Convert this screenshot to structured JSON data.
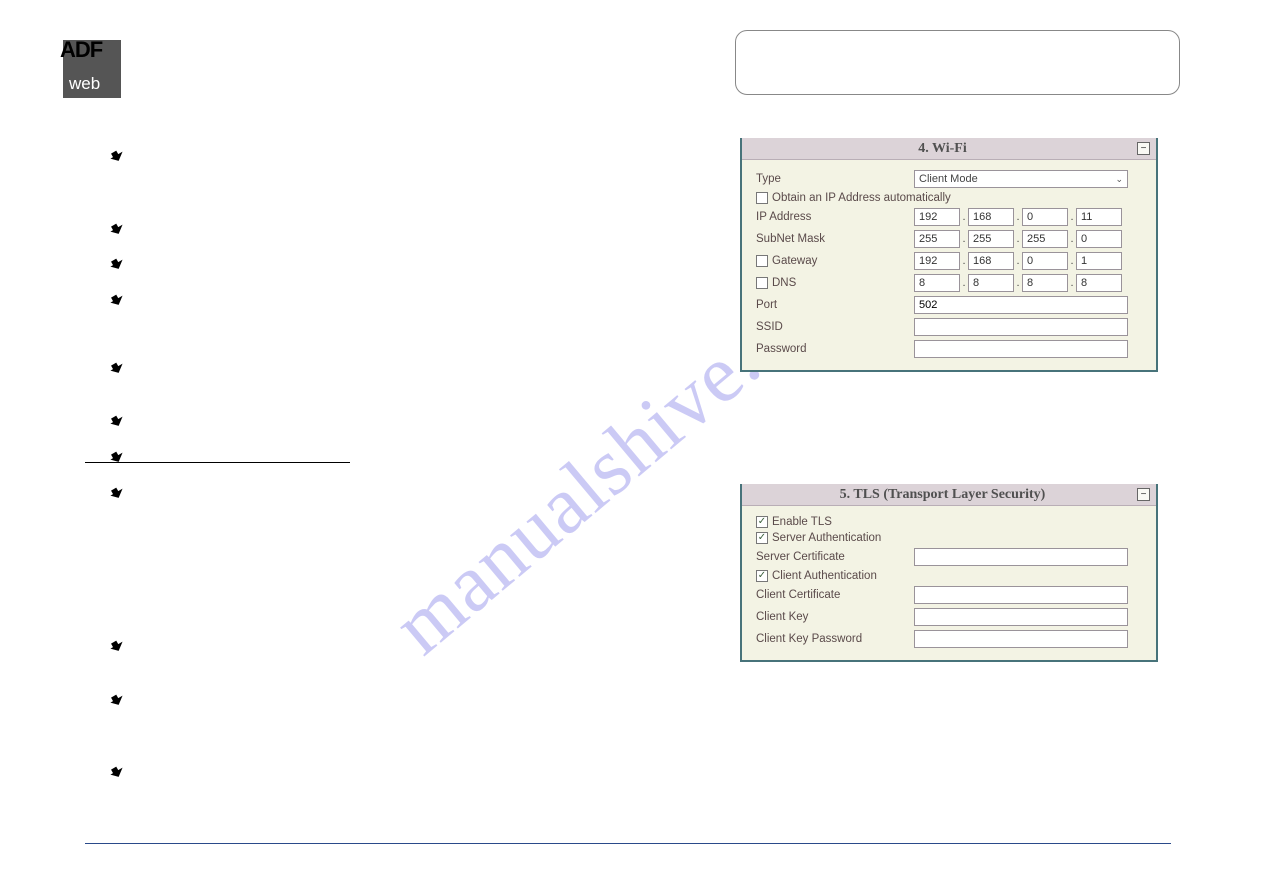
{
  "watermark": "manualshive.com",
  "logo": {
    "line1": "ADF",
    "line2": "web"
  },
  "panels": {
    "wifi": {
      "title": "4. Wi-Fi",
      "type_label": "Type",
      "type_value": "Client Mode",
      "obtain_ip_label": "Obtain an IP Address automatically",
      "obtain_ip_checked": false,
      "ip_label": "IP Address",
      "ip": [
        "192",
        "168",
        "0",
        "11"
      ],
      "subnet_label": "SubNet Mask",
      "subnet": [
        "255",
        "255",
        "255",
        "0"
      ],
      "gateway_label": "Gateway",
      "gateway_checked": false,
      "gateway": [
        "192",
        "168",
        "0",
        "1"
      ],
      "dns_label": "DNS",
      "dns_checked": false,
      "dns": [
        "8",
        "8",
        "8",
        "8"
      ],
      "port_label": "Port",
      "port_value": "502",
      "ssid_label": "SSID",
      "ssid_value": "",
      "password_label": "Password",
      "password_value": ""
    },
    "tls": {
      "title": "5. TLS (Transport Layer Security)",
      "enable_label": "Enable TLS",
      "enable_checked": true,
      "server_auth_label": "Server Authentication",
      "server_auth_checked": true,
      "server_cert_label": "Server Certificate",
      "server_cert_value": "",
      "client_auth_label": "Client Authentication",
      "client_auth_checked": true,
      "client_cert_label": "Client Certificate",
      "client_cert_value": "",
      "client_key_label": "Client Key",
      "client_key_value": "",
      "client_key_pw_label": "Client Key Password",
      "client_key_pw_value": ""
    }
  }
}
